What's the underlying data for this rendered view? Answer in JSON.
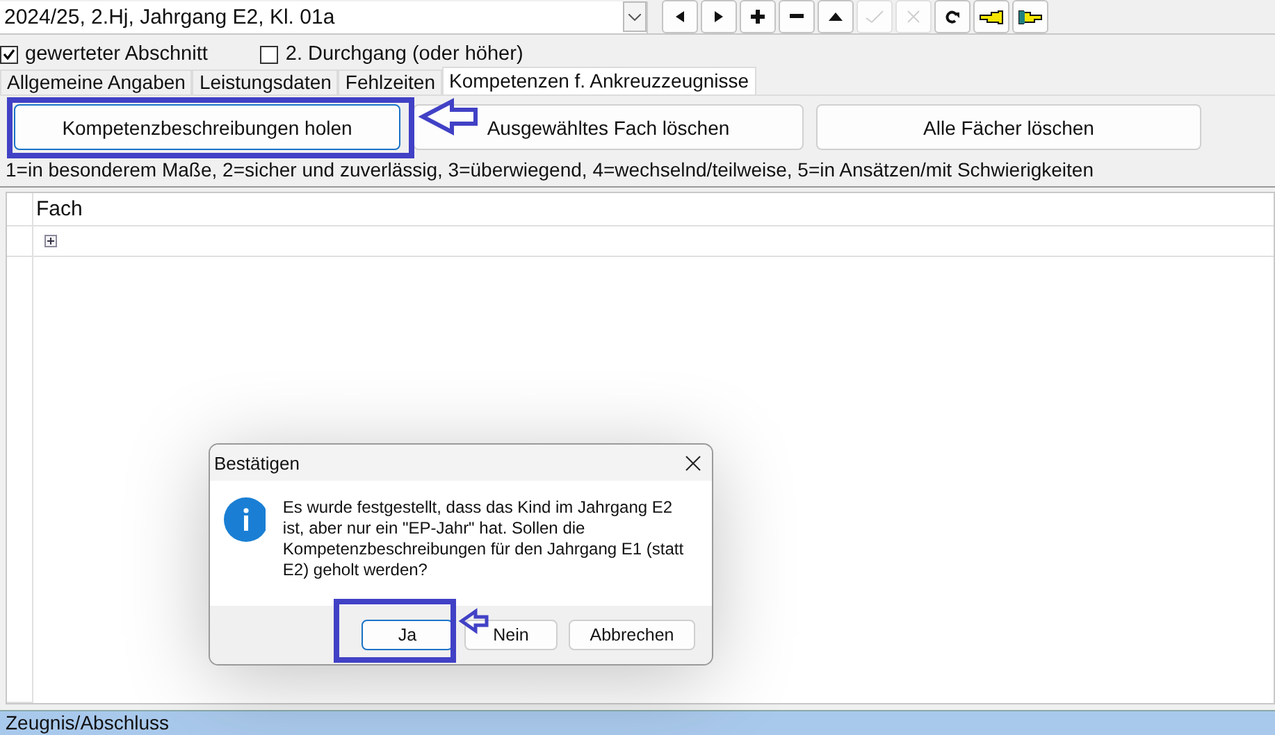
{
  "header": {
    "selector_value": "2024/25, 2.Hj, Jahrgang E2, Kl. 01a"
  },
  "toolbar": [
    {
      "kind": "prev",
      "disabled": false
    },
    {
      "kind": "next",
      "disabled": false
    },
    {
      "kind": "add",
      "disabled": false
    },
    {
      "kind": "remove",
      "disabled": false
    },
    {
      "kind": "up",
      "disabled": false
    },
    {
      "kind": "confirm",
      "disabled": true
    },
    {
      "kind": "cancel",
      "disabled": true
    },
    {
      "kind": "refresh",
      "disabled": false
    },
    {
      "kind": "hand_left",
      "disabled": false
    },
    {
      "kind": "hand_right",
      "disabled": false
    }
  ],
  "options": [
    {
      "label": "gewerteter Abschnitt",
      "checked": true
    },
    {
      "label": "2. Durchgang (oder höher)",
      "checked": false
    }
  ],
  "tabs": [
    {
      "label": "Allgemeine Angaben",
      "selected": false
    },
    {
      "label": "Leistungsdaten",
      "selected": false
    },
    {
      "label": "Fehlzeiten",
      "selected": false
    },
    {
      "label": "Kompetenzen f. Ankreuzzeugnisse",
      "selected": true
    }
  ],
  "actions": [
    "Kompetenzbeschreibungen holen",
    "Ausgewähltes Fach löschen",
    "Alle Fächer löschen"
  ],
  "legend": "1=in besonderem Maße, 2=sicher und zuverlässig, 3=überwiegend, 4=wechselnd/teilweise, 5=in Ansätzen/mit Schwierigkeiten",
  "table": {
    "columns": [
      "Fach"
    ],
    "rows": [
      {
        "expanded": false
      }
    ]
  },
  "dialog": {
    "title": "Bestätigen",
    "message": "Es wurde festgestellt, dass das Kind im Jahrgang E2 ist, aber nur ein \"EP-Jahr\" hat. Sollen die Kompetenzbeschreibungen für den Jahrgang E1 (statt E2) geholt werden?",
    "buttons": [
      {
        "label": "Ja",
        "default": true
      },
      {
        "label": "Nein",
        "default": false
      },
      {
        "label": "Abbrechen",
        "default": false
      }
    ]
  },
  "status_bar": {
    "text": "Zeugnis/Abschluss"
  }
}
